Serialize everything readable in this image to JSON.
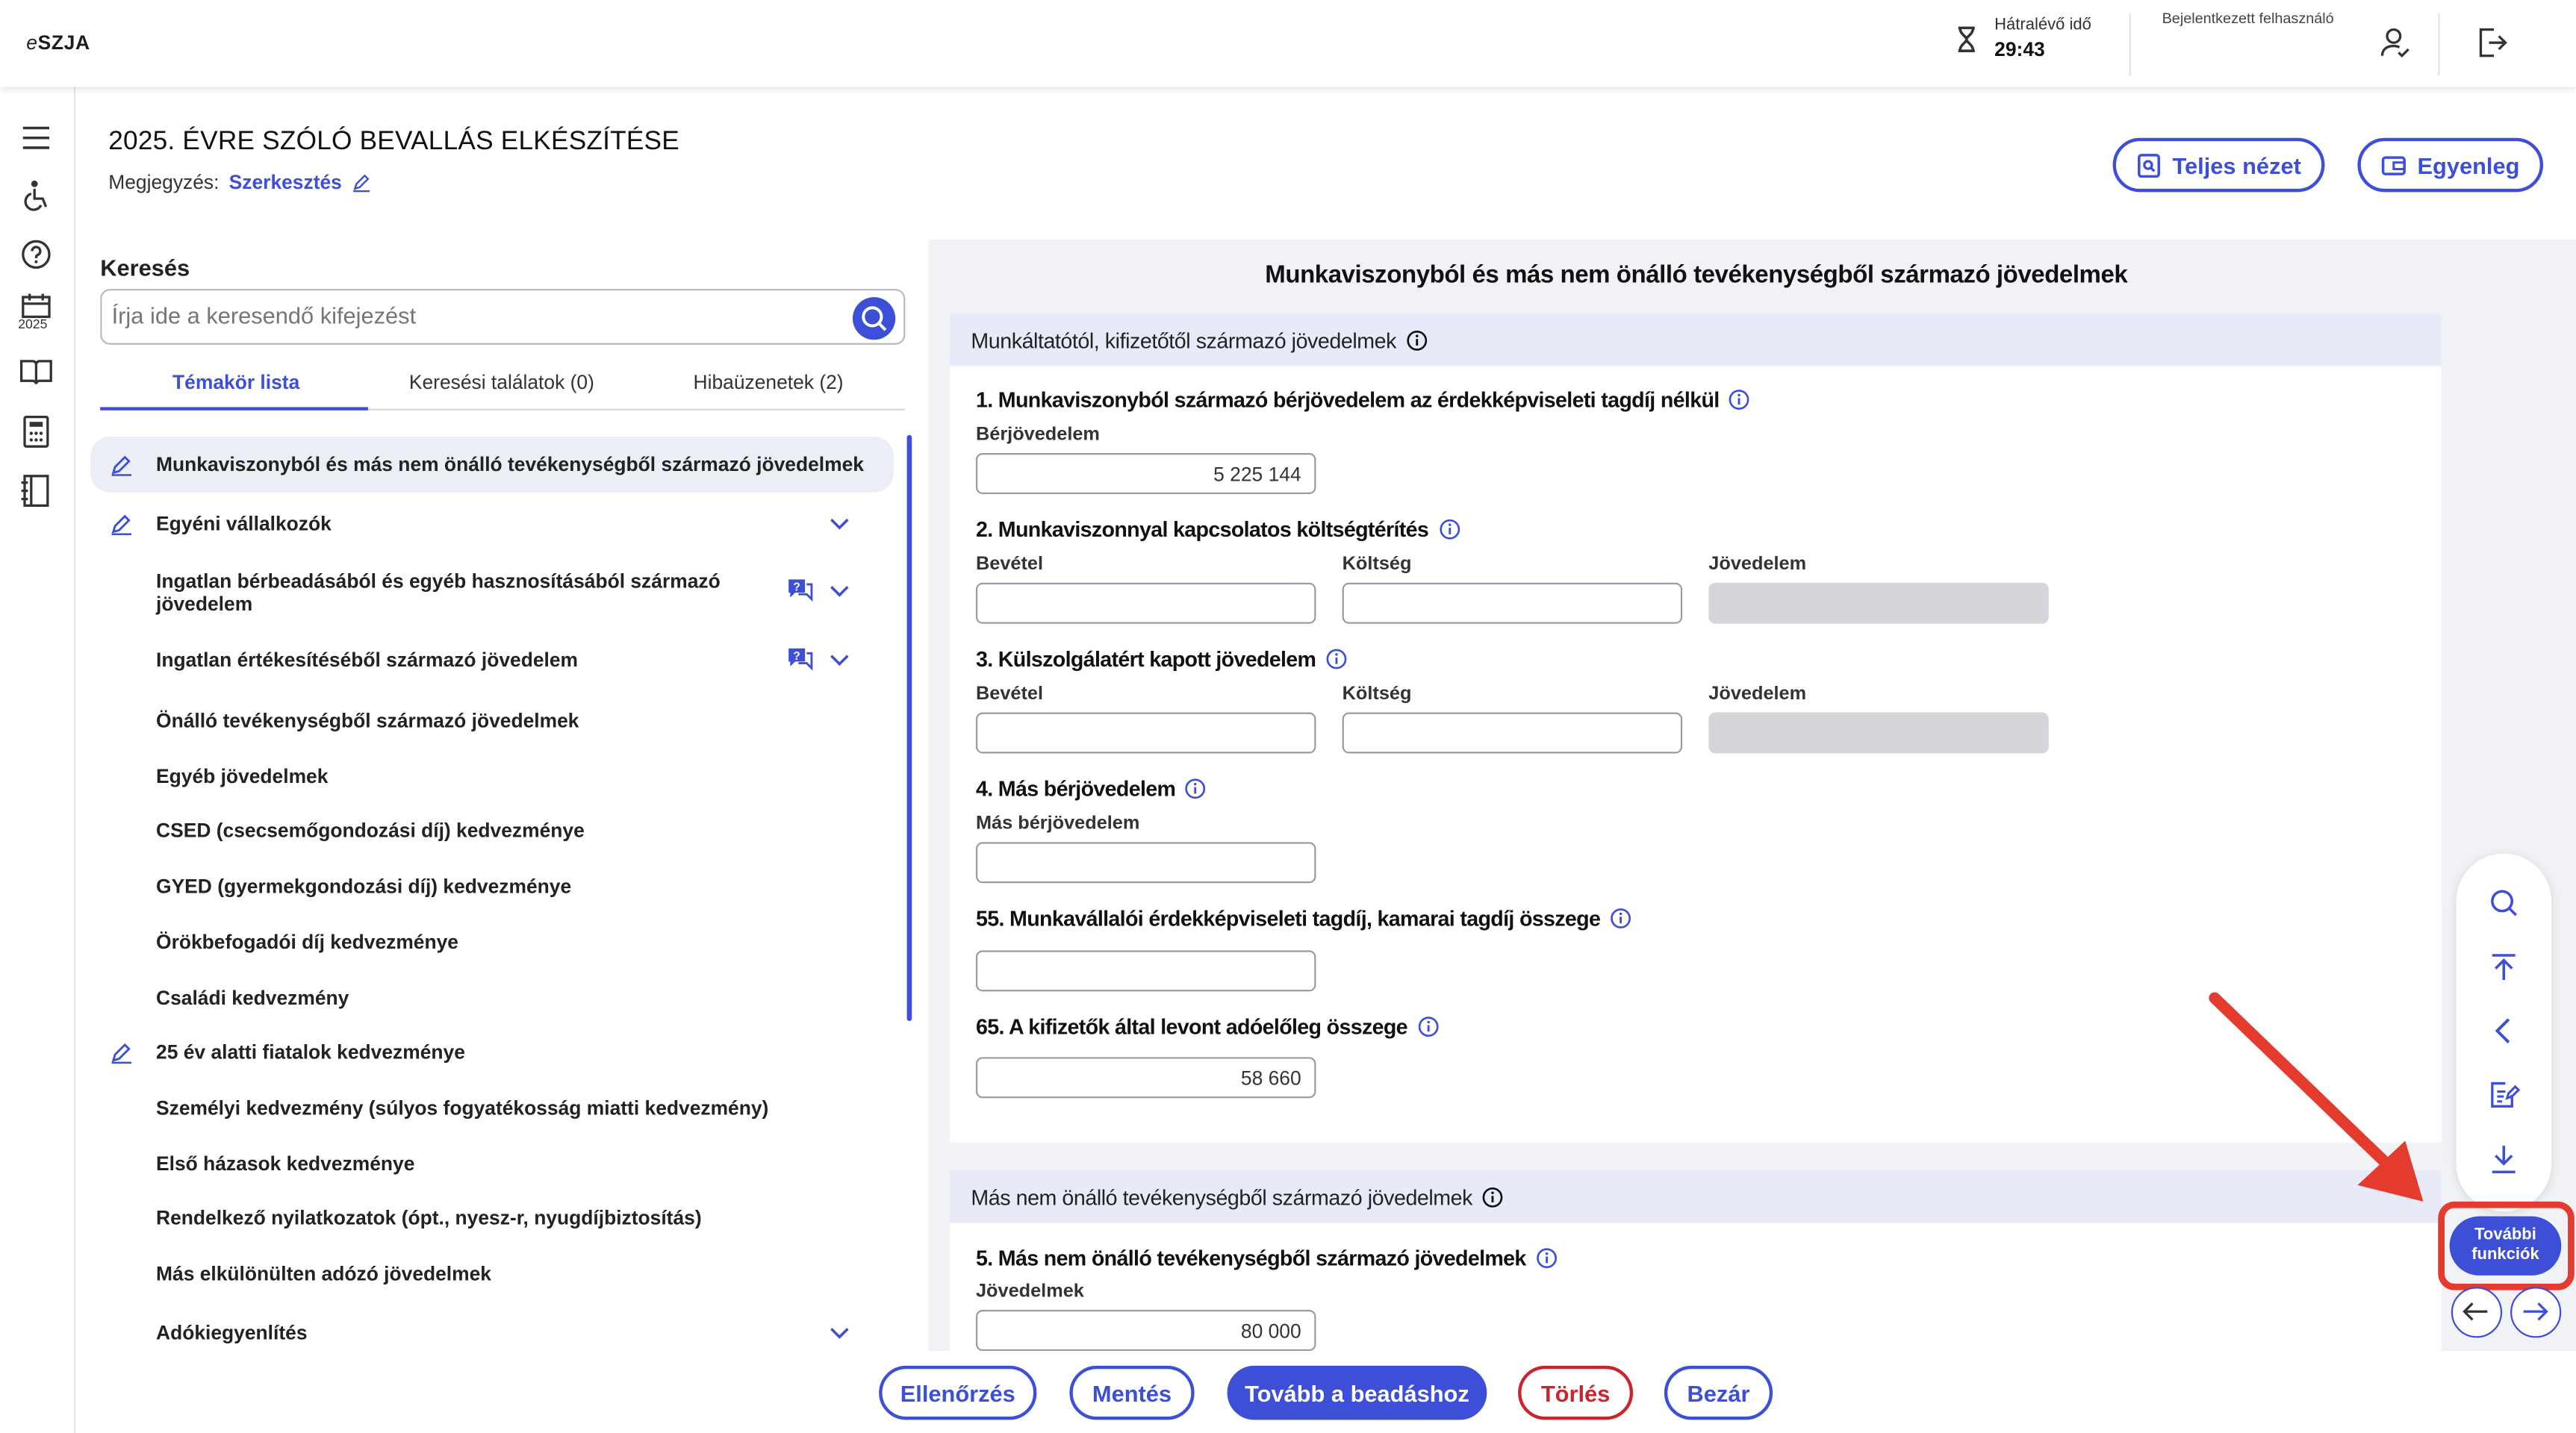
{
  "app": {
    "logo_prefix": "e",
    "logo_main": "SZJA"
  },
  "topbar": {
    "timer_label": "Hátralévő idő",
    "timer_value": "29:43",
    "user_label": "Bejelentkezett felhasználó"
  },
  "leftnav": {
    "year": "2025"
  },
  "header": {
    "title": "2025. ÉVRE SZÓLÓ BEVALLÁS ELKÉSZÍTÉSE",
    "note_label": "Megjegyzés:",
    "note_link": "Szerkesztés",
    "full_view": "Teljes nézet",
    "balance": "Egyenleg"
  },
  "search": {
    "title": "Keresés",
    "placeholder": "Írja ide a keresendő kifejezést",
    "tabs": [
      "Témakör lista",
      "Keresési találatok (0)",
      "Hibaüzenetek (2)"
    ]
  },
  "topics": [
    "Munkaviszonyból és más nem önálló tevékenységből származó jövedelmek",
    "Egyéni vállalkozók",
    "Ingatlan bérbeadásából és egyéb hasznosításából származó jövedelem",
    "Ingatlan értékesítéséből származó jövedelem",
    "Önálló tevékenységből származó jövedelmek",
    "Egyéb jövedelmek",
    "CSED (csecsemőgondozási díj) kedvezménye",
    "GYED (gyermekgondozási díj) kedvezménye",
    "Örökbefogadói díj kedvezménye",
    "Családi kedvezmény",
    "25 év alatti fiatalok kedvezménye",
    "Személyi kedvezmény (súlyos fogyatékosság miatti kedvezmény)",
    "Első házasok kedvezménye",
    "Rendelkező nyilatkozatok (ópt., nyesz-r, nyugdíjbiztosítás)",
    "Más elkülönülten adózó jövedelmek",
    "Adókiegyenlítés"
  ],
  "form": {
    "title": "Munkaviszonyból és más nem önálló tevékenységből származó jövedelmek",
    "section1": "Munkáltatótól, kifizetőtől származó jövedelmek",
    "q1": "1. Munkaviszonyból származó bérjövedelem az érdekképviseleti tagdíj nélkül",
    "q1_label": "Bérjövedelem",
    "q1_value": "5 225 144",
    "q2": "2. Munkaviszonnyal kapcsolatos költségtérítés",
    "q3": "3. Külszolgálatért kapott jövedelem",
    "lbl_income": "Bevétel",
    "lbl_cost": "Költség",
    "lbl_profit": "Jövedelem",
    "q4": "4. Más bérjövedelem",
    "q4_label": "Más bérjövedelem",
    "q55": "55. Munkavállalói érdekképviseleti tagdíj, kamarai tagdíj összege",
    "q65": "65. A kifizetők által levont adóelőleg összege",
    "q65_value": "58 660",
    "section2": "Más nem önálló tevékenységből származó jövedelmek",
    "q5": "5. Más nem önálló tevékenységből származó jövedelmek",
    "q5_label": "Jövedelmek",
    "q5_value": "80 000"
  },
  "float": {
    "more_line1": "További",
    "more_line2": "funkciók"
  },
  "bottom": {
    "check": "Ellenőrzés",
    "save": "Mentés",
    "submit": "Tovább a beadáshoz",
    "delete": "Törlés",
    "close": "Bezár"
  },
  "colors": {
    "accent": "#3d4fd6",
    "danger": "#c8262c",
    "highlight": "#e53a2e"
  }
}
